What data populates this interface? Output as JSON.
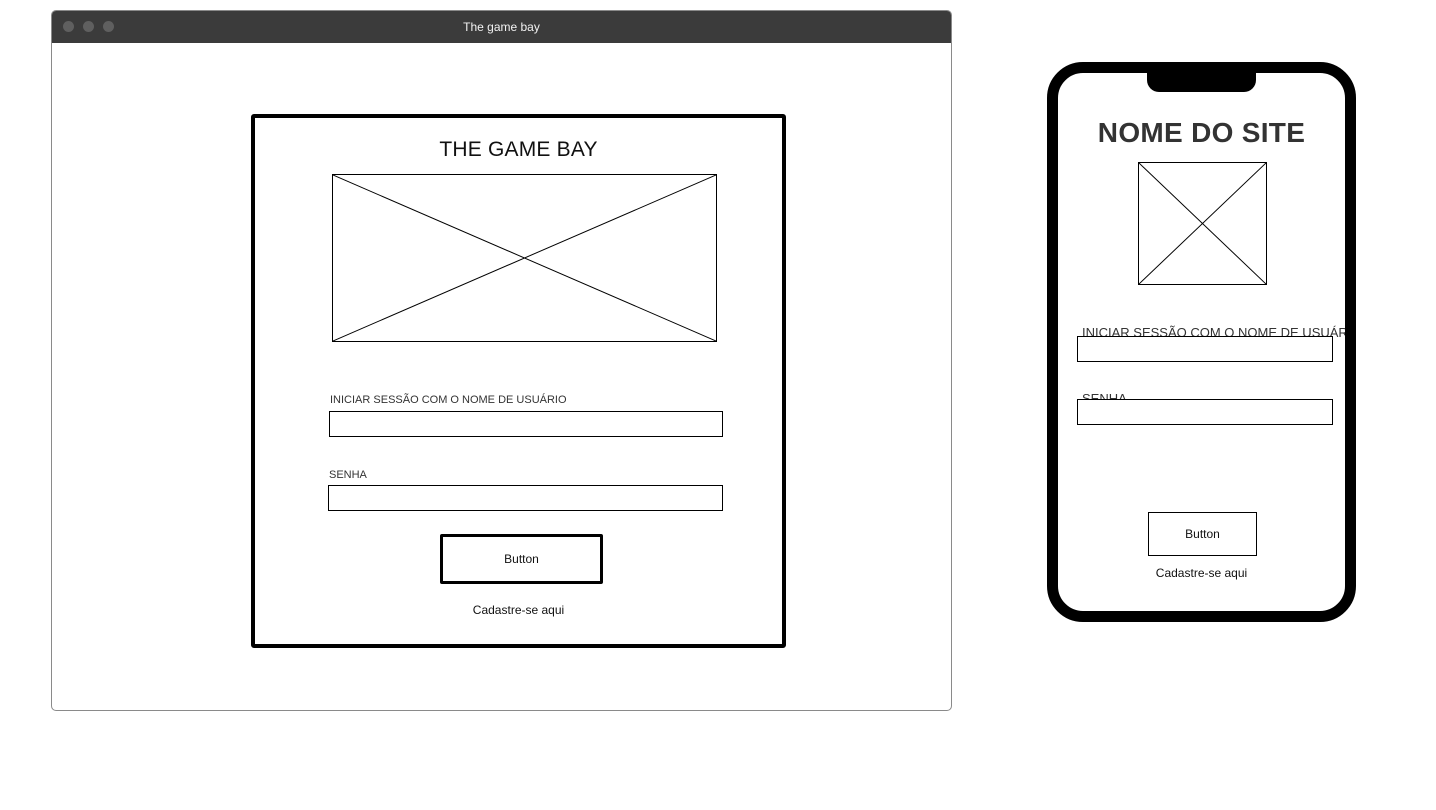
{
  "desktop": {
    "window_title": "The game bay",
    "card_title": "THE GAME BAY",
    "username_label": "INICIAR SESSÃO COM O NOME DE USUÁRIO",
    "username_value": "",
    "password_label": "SENHA",
    "password_value": "",
    "button_label": "Button",
    "signup_link": "Cadastre-se aqui"
  },
  "mobile": {
    "site_title": "NOME DO SITE",
    "username_label": "INICIAR SESSÃO COM O NOME DE USUÁRIO",
    "username_value": "",
    "password_label": "SENHA",
    "password_value": "",
    "button_label": "Button",
    "signup_link": "Cadastre-se aqui"
  },
  "colors": {
    "titlebar": "#3b3b3b",
    "frame": "#000000",
    "background": "#ffffff"
  }
}
